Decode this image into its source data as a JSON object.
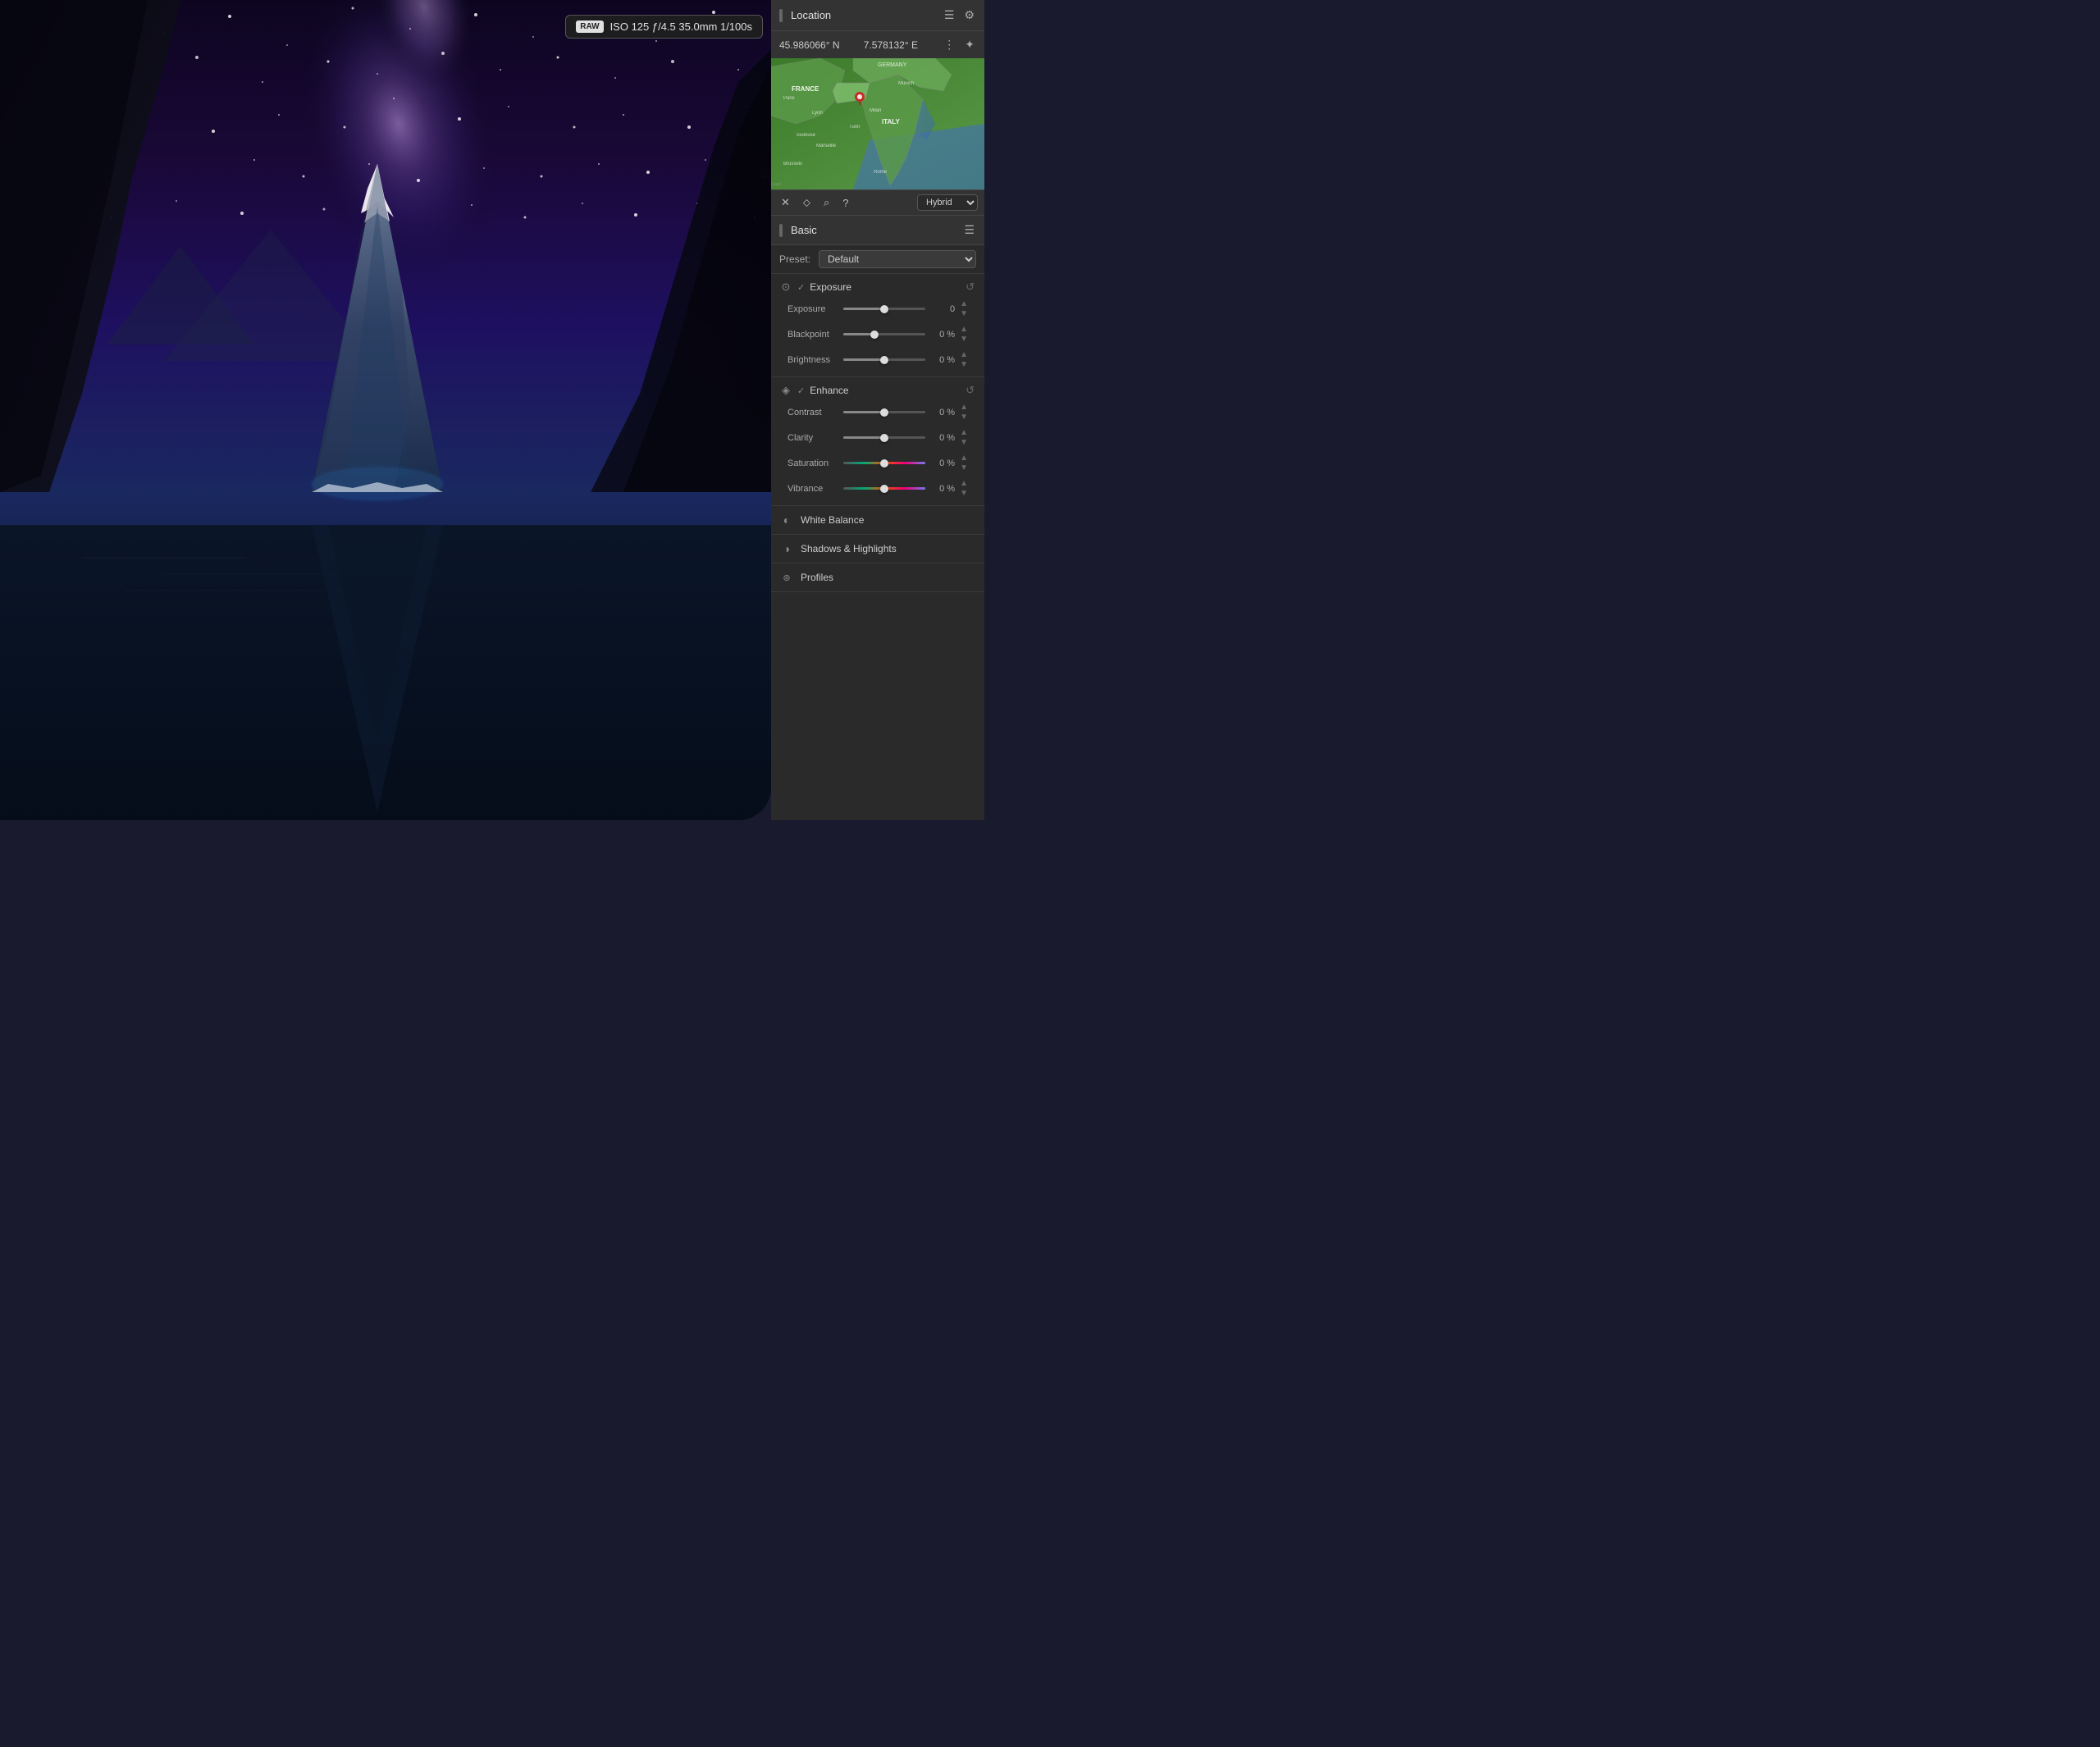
{
  "camera": {
    "raw_label": "RAW",
    "info": "ISO 125 ƒ/4.5 35.0mm 1/100s"
  },
  "location": {
    "title": "Location",
    "lat": "45.986066° N",
    "lon": "7.578132° E",
    "map_type": "Hybrid"
  },
  "basic": {
    "title": "Basic",
    "preset_label": "Preset:",
    "preset_value": "Default",
    "exposure_section": "Exposure",
    "enhance_section": "Enhance",
    "sliders": [
      {
        "name": "Exposure",
        "value": "0",
        "position": 0.5
      },
      {
        "name": "Blackpoint",
        "value": "0 %",
        "position": 0.38
      },
      {
        "name": "Brightness",
        "value": "0 %",
        "position": 0.5
      }
    ],
    "enhance_sliders": [
      {
        "name": "Contrast",
        "value": "0 %",
        "position": 0.5
      },
      {
        "name": "Clarity",
        "value": "0 %",
        "position": 0.5
      },
      {
        "name": "Saturation",
        "value": "0 %",
        "position": 0.5,
        "type": "saturation"
      },
      {
        "name": "Vibrance",
        "value": "0 %",
        "position": 0.5,
        "type": "vibrance"
      }
    ]
  },
  "collapsed_sections": [
    {
      "label": "White Balance",
      "icon": "wb"
    },
    {
      "label": "Shadows & Highlights",
      "icon": "sh"
    },
    {
      "label": "Profiles",
      "icon": "pr"
    }
  ]
}
